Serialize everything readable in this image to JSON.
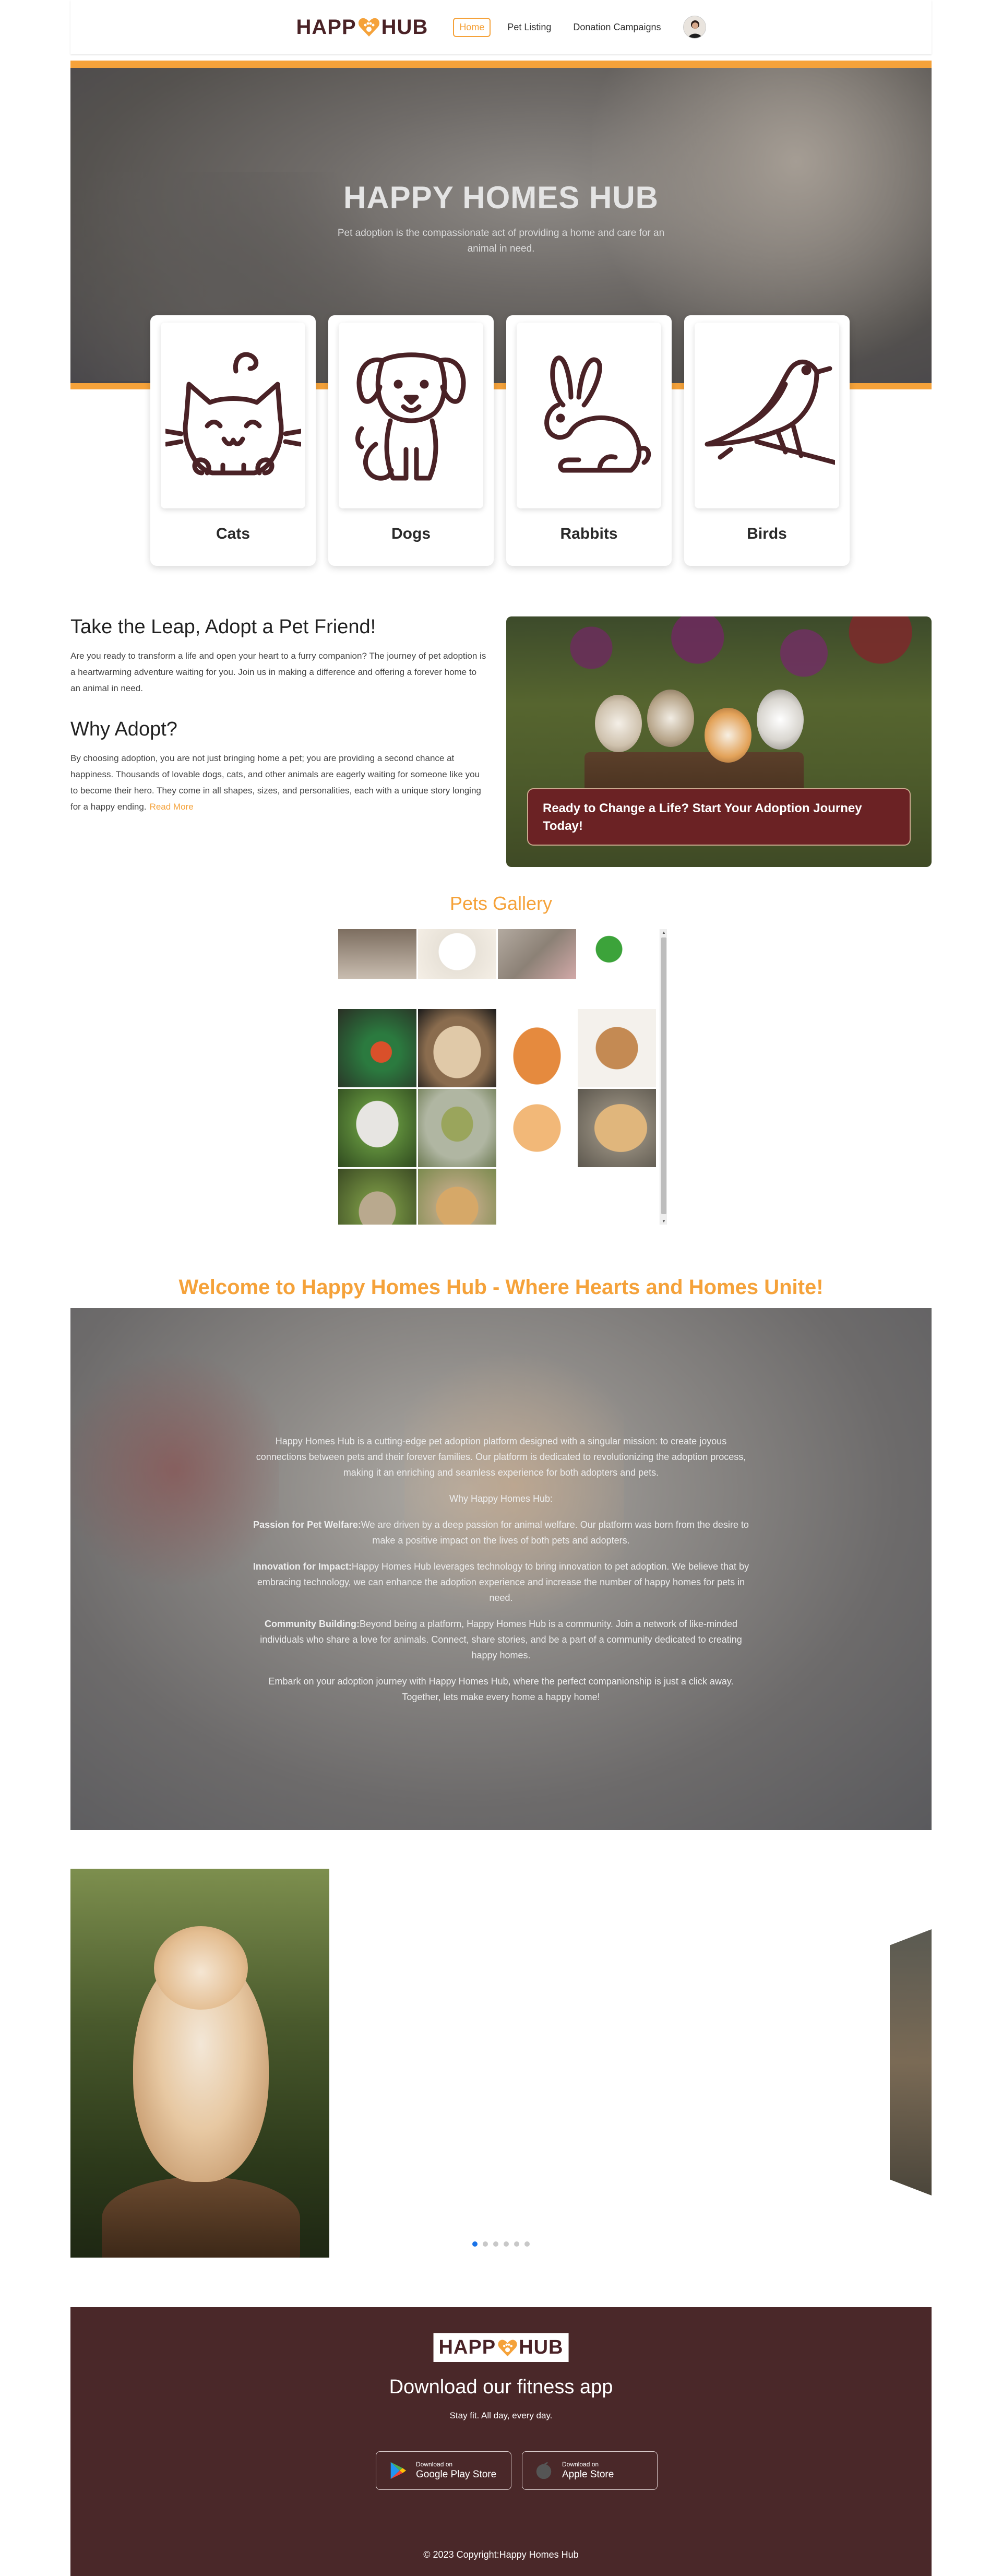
{
  "brand": {
    "logo_left": "HAPP",
    "logo_right": "HUB",
    "brand_color": "#4a2226",
    "accent": "#f5a23a"
  },
  "nav": {
    "items": [
      {
        "label": "Home",
        "active": true
      },
      {
        "label": "Pet Listing",
        "active": false
      },
      {
        "label": "Donation Campaigns",
        "active": false
      }
    ]
  },
  "hero": {
    "title": "HAPPY HOMES HUB",
    "subtitle": "Pet adoption is the compassionate act of providing a home and care for an animal in need."
  },
  "categories": [
    {
      "label": "Cats",
      "icon": "cat-icon"
    },
    {
      "label": "Dogs",
      "icon": "dog-icon"
    },
    {
      "label": "Rabbits",
      "icon": "rabbit-icon"
    },
    {
      "label": "Birds",
      "icon": "bird-icon"
    }
  ],
  "adopt": {
    "heading1": "Take the Leap, Adopt a Pet Friend!",
    "paragraph1": "Are you ready to transform a life and open your heart to a furry companion? The journey of pet adoption is a heartwarming adventure waiting for you. Join us in making a difference and offering a forever home to an animal in need.",
    "heading2": "Why Adopt?",
    "paragraph2": "By choosing adoption, you are not just bringing home a pet; you are providing a second chance at happiness. Thousands of lovable dogs, cats, and other animals are eagerly waiting for someone like you to become their hero. They come in all shapes, sizes, and personalities, each with a unique story longing for a happy ending.",
    "read_more": "Read More",
    "banner": "Ready to Change a Life? Start Your Adoption Journey Today!"
  },
  "gallery": {
    "title": "Pets Gallery"
  },
  "welcome": {
    "title": "Welcome to Happy Homes Hub - Where Hearts and Homes Unite!",
    "intro": "Happy Homes Hub is a cutting-edge pet adoption platform designed with a singular mission: to create joyous connections between pets and their forever families. Our platform is dedicated to revolutionizing the adoption process, making it an enriching and seamless experience for both adopters and pets.",
    "why_heading": "Why Happy Homes Hub:",
    "points": [
      {
        "title": "Passion for Pet Welfare:",
        "text": "We are driven by a deep passion for animal welfare. Our platform was born from the desire to make a positive impact on the lives of both pets and adopters."
      },
      {
        "title": "Innovation for Impact:",
        "text": "Happy Homes Hub leverages technology to bring innovation to pet adoption. We believe that by embracing technology, we can enhance the adoption experience and increase the number of happy homes for pets in need."
      },
      {
        "title": "Community Building:",
        "text": "Beyond being a platform, Happy Homes Hub is a community. Join a network of like-minded individuals who share a love for animals. Connect, share stories, and be a part of a community dedicated to creating happy homes."
      }
    ],
    "closing": "Embark on your adoption journey with Happy Homes Hub, where the perfect companionship is just a click away. Together, lets make every home a happy home!"
  },
  "carousel": {
    "slide_count": 6,
    "active_index": 0
  },
  "footer": {
    "title": "Download our fitness app",
    "subtitle": "Stay fit. All day, every day.",
    "google_small": "Download on",
    "google_big": "Google Play Store",
    "apple_small": "Download on",
    "apple_big": "Apple Store",
    "copyright": "© 2023 Copyright:Happy Homes Hub",
    "bg": "#4a2829"
  }
}
